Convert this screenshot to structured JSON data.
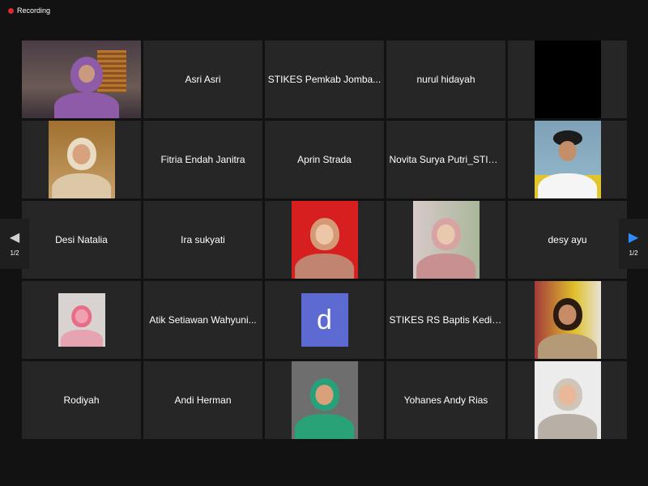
{
  "recording": {
    "label": "Recording"
  },
  "pager": {
    "left_label": "1/2",
    "right_label": "1/2"
  },
  "tiles": {
    "r1c2": "Asri Asri",
    "r1c3": "STIKES Pemkab Jomba...",
    "r1c4": "nurul hidayah",
    "r2c2": "Fitria Endah Janitra",
    "r2c3": "Aprin Strada",
    "r2c4": "Novita Surya Putri_STIK...",
    "r3c1": "Desi Natalia",
    "r3c2": "Ira sukyati",
    "r3c5": "desy ayu",
    "r4c2": "Atik Setiawan Wahyuni...",
    "r4c3_avatar": "d",
    "r4c4": "STIKES RS Baptis Kedir...",
    "r5c1": "Rodiyah",
    "r5c2": "Andi Herman",
    "r5c4": "Yohanes Andy Rias"
  },
  "colors": {
    "active_speaker_border": "#c9d85a",
    "recording_dot": "#e02828",
    "tile_background": "#262626",
    "avatar_background": "#5c6ad2",
    "next_arrow": "#2d8cff"
  }
}
